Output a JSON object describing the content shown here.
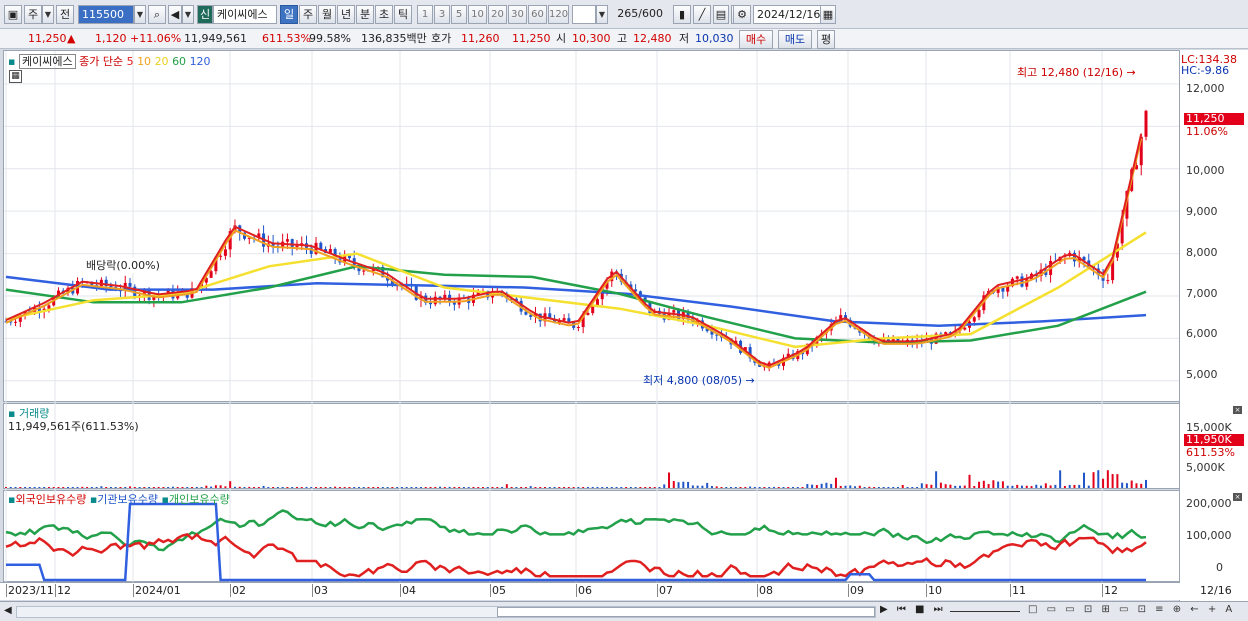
{
  "toolbar": {
    "period1": "주",
    "period2": "전",
    "code": "115500",
    "new_label": "신",
    "stock_name": "케이씨에스",
    "tabs": [
      "일",
      "주",
      "월",
      "년",
      "분",
      "초",
      "틱"
    ],
    "active_tab": "일",
    "intervals": [
      "1",
      "3",
      "5",
      "10",
      "20",
      "30",
      "60",
      "120"
    ],
    "count": "265",
    "count_max": "/600",
    "date": "2024/12/16"
  },
  "quote": {
    "price": "11,250",
    "arrow": "▲",
    "change": "1,120",
    "change_pct": "+11.06%",
    "volume": "11,949,561",
    "vol_ratio": "611.53%",
    "rate": "99.58%",
    "amount": "136,835백만",
    "hoga_label": "호가",
    "hoga_ask": "11,260",
    "hoga_bid": "11,250",
    "open_label": "시",
    "open": "10,300",
    "high_label": "고",
    "high": "12,480",
    "low_label": "저",
    "low": "10,030",
    "buy": "매수",
    "sell": "매도",
    "avg": "평"
  },
  "colors": {
    "up": "#e3001b",
    "down": "#1f55c8",
    "ma5": "#e02020",
    "ma10": "#f0a020",
    "ma20": "#f5e030",
    "ma60": "#22a04a",
    "ma120": "#3060e0"
  },
  "price_panel": {
    "name": "케이씨에스",
    "ma_label": "종가 단순",
    "ma_periods": [
      "5",
      "10",
      "20",
      "60",
      "120"
    ],
    "lc": "LC:134.38",
    "hc": "HC:-9.86",
    "high_note": "최고 12,480 (12/16)",
    "low_note": "최저 4,800 (08/05)",
    "dividend_note": "배당락(0.00%)",
    "y_ticks": [
      "12,000",
      "11,000",
      "10,000",
      "9,000",
      "8,000",
      "7,000",
      "6,000",
      "5,000"
    ],
    "current_price": "11,250",
    "current_pct": "11.06%"
  },
  "volume_panel": {
    "name": "거래량",
    "value": "11,949,561주(611.53%)",
    "y_ticks": [
      "15,000K",
      "10,000K",
      "5,000K"
    ],
    "current": "11,950K",
    "current_pct": "611.53%"
  },
  "holder_panel": {
    "series": [
      "외국인보유수량",
      "기관보유수량",
      "개인보유수량"
    ],
    "y_ticks": [
      "200,000",
      "100,000",
      "0"
    ]
  },
  "x_axis": {
    "labels": [
      "2023/11",
      "12",
      "2024/01",
      "02",
      "03",
      "04",
      "05",
      "06",
      "07",
      "08",
      "09",
      "10",
      "11",
      "12"
    ],
    "last": "12/16"
  },
  "chart_data": {
    "type": "candlestick",
    "price_ylim": [
      4500,
      12800
    ],
    "months": [
      "2023/11",
      "12",
      "2024/01",
      "02",
      "03",
      "04",
      "05",
      "06",
      "07",
      "08",
      "09",
      "10",
      "11",
      "12"
    ],
    "close_path": [
      [
        "2023/11",
        6400
      ],
      [
        "12",
        6800
      ],
      [
        "12",
        7300
      ],
      [
        "2024/01",
        7200
      ],
      [
        "01",
        7000
      ],
      [
        "02",
        7100
      ],
      [
        "02",
        8600
      ],
      [
        "02",
        8200
      ],
      [
        "03",
        8150
      ],
      [
        "03",
        7800
      ],
      [
        "04",
        7500
      ],
      [
        "04",
        6900
      ],
      [
        "05",
        6900
      ],
      [
        "05",
        7100
      ],
      [
        "06",
        6500
      ],
      [
        "06",
        6300
      ],
      [
        "06",
        7600
      ],
      [
        "07",
        6600
      ],
      [
        "07",
        6500
      ],
      [
        "08",
        6000
      ],
      [
        "08",
        5300
      ],
      [
        "08",
        5700
      ],
      [
        "09",
        6500
      ],
      [
        "09",
        5900
      ],
      [
        "10",
        5900
      ],
      [
        "10",
        6100
      ],
      [
        "10",
        7200
      ],
      [
        "11",
        7400
      ],
      [
        "11",
        8000
      ],
      [
        "12",
        7400
      ],
      [
        "12",
        11250
      ]
    ],
    "ma120_path": [
      [
        "2023/11",
        7450
      ],
      [
        "2024/01",
        7150
      ],
      [
        "02",
        7150
      ],
      [
        "03",
        7300
      ],
      [
        "04",
        7250
      ],
      [
        "06",
        7200
      ],
      [
        "07",
        7050
      ],
      [
        "08",
        6750
      ],
      [
        "09",
        6400
      ],
      [
        "10",
        6300
      ],
      [
        "11",
        6400
      ],
      [
        "12",
        6550
      ]
    ],
    "ma60_path": [
      [
        "2023/11",
        7150
      ],
      [
        "12",
        6850
      ],
      [
        "2024/01",
        6850
      ],
      [
        "02",
        7200
      ],
      [
        "03",
        7700
      ],
      [
        "04",
        7500
      ],
      [
        "05",
        7450
      ],
      [
        "06",
        7050
      ],
      [
        "07",
        6500
      ],
      [
        "08",
        6000
      ],
      [
        "09",
        5900
      ],
      [
        "10",
        5950
      ],
      [
        "11",
        6300
      ],
      [
        "12",
        7100
      ]
    ],
    "ma20_path": [
      [
        "2023/11",
        6450
      ],
      [
        "12",
        6900
      ],
      [
        "2024/01",
        7050
      ],
      [
        "02",
        7700
      ],
      [
        "03",
        8000
      ],
      [
        "04",
        7200
      ],
      [
        "05",
        6950
      ],
      [
        "06",
        6700
      ],
      [
        "07",
        6300
      ],
      [
        "08",
        5800
      ],
      [
        "09",
        6000
      ],
      [
        "10",
        6100
      ],
      [
        "11",
        7200
      ],
      [
        "12",
        8500
      ]
    ],
    "volume_k": [
      200,
      300,
      250,
      400,
      600,
      300,
      150,
      2200,
      800,
      400,
      300,
      250,
      200,
      300,
      150,
      250,
      200,
      900,
      400,
      200,
      150,
      200,
      300,
      6000,
      2000,
      300,
      400,
      200,
      5000,
      2500,
      300,
      600,
      5500,
      3500,
      7000,
      2500,
      4500,
      3500,
      17000,
      8000
    ],
    "holdings": {
      "foreign_range": [
        0,
        100000
      ],
      "institution_range": [
        0,
        200000
      ],
      "individual_range": [
        0,
        150000
      ]
    }
  }
}
